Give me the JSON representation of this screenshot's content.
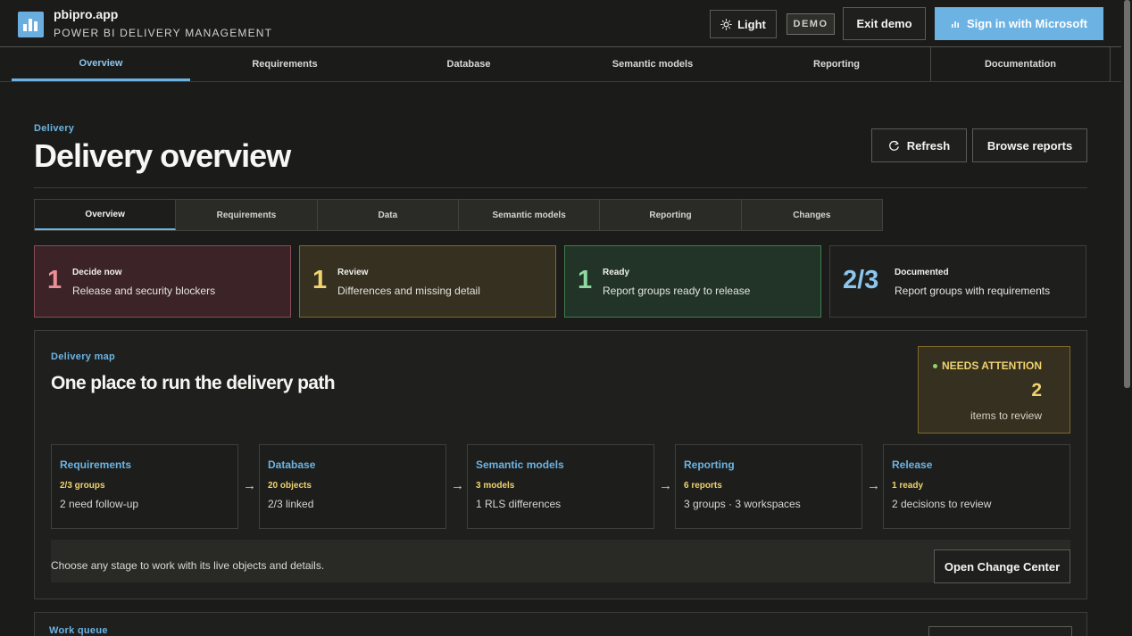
{
  "app": {
    "name": "pbipro.app",
    "subtitle": "POWER BI DELIVERY MANAGEMENT",
    "light_label": "Light",
    "demo_badge": "DEMO",
    "exit_label": "Exit demo",
    "signin_label": "Sign in with Microsoft"
  },
  "nav": {
    "items": [
      "Overview",
      "Requirements",
      "Database",
      "Semantic models",
      "Reporting",
      "Documentation"
    ],
    "active": "Overview"
  },
  "page": {
    "eyebrow": "Delivery",
    "title": "Delivery overview",
    "refresh_label": "Refresh",
    "browse_label": "Browse reports"
  },
  "subtabs": {
    "items": [
      "Overview",
      "Requirements",
      "Data",
      "Semantic models",
      "Reporting",
      "Changes"
    ],
    "active": "Overview"
  },
  "stats": [
    {
      "value": "1",
      "label": "Decide now",
      "desc": "Release and security blockers",
      "color": "#ea8f96"
    },
    {
      "value": "1",
      "label": "Review",
      "desc": "Differences and missing detail",
      "color": "#f0d26e"
    },
    {
      "value": "1",
      "label": "Ready",
      "desc": "Report groups ready to release",
      "color": "#8fd8a0"
    },
    {
      "value": "2/3",
      "label": "Documented",
      "desc": "Report groups with requirements",
      "color": "#8cc6ee"
    }
  ],
  "map": {
    "eyebrow": "Delivery map",
    "title": "One place to run the delivery path",
    "attention": {
      "label": "NEEDS ATTENTION",
      "count": "2",
      "sub": "items to review"
    },
    "stages": [
      {
        "name": "Requirements",
        "metric": "2/3 groups",
        "note": "2 need follow-up"
      },
      {
        "name": "Database",
        "metric": "20 objects",
        "note": "2/3 linked"
      },
      {
        "name": "Semantic models",
        "metric": "3 models",
        "note": "1 RLS differences"
      },
      {
        "name": "Reporting",
        "metric": "6 reports",
        "note": "3 groups · 3 workspaces"
      },
      {
        "name": "Release",
        "metric": "1 ready",
        "note": "2 decisions to review"
      }
    ],
    "footer_text": "Choose any stage to work with its live objects and details.",
    "change_center_label": "Open Change Center"
  },
  "queue": {
    "eyebrow": "Work queue"
  },
  "colors": {
    "accent": "#6cb3e4",
    "warning": "#f0d26e",
    "background": "#1b1c19"
  }
}
